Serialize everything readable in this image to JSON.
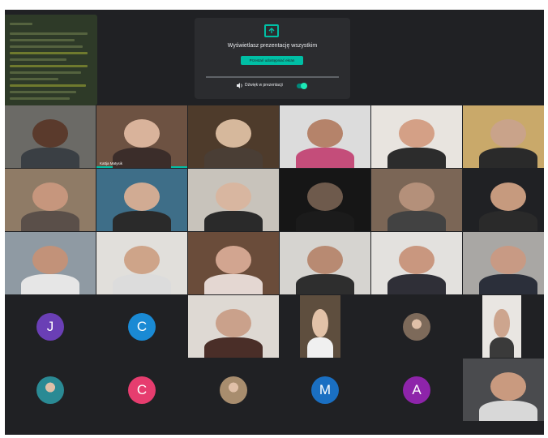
{
  "presentation": {
    "message": "Wyświetlasz prezentację wszystkim",
    "stop_label": "Przestań udostępniać ekran",
    "audio_label": "Dźwięk w prezentacji",
    "audio_on": true
  },
  "tiles": [
    {
      "name": "",
      "bg": "#6b6a66",
      "face": "#5a3a2c",
      "body": "#3a3f44"
    },
    {
      "name": "Kattja Matysik",
      "bg": "#6d5242",
      "face": "#d9b39b",
      "body": "#3b2d2a",
      "speaking": true
    },
    {
      "name": "",
      "bg": "#4e3b2b",
      "face": "#d6b89c",
      "body": "#4a3e35"
    },
    {
      "name": "",
      "bg": "#dcdcdc",
      "face": "#b5836a",
      "body": "#c44d7a"
    },
    {
      "name": "",
      "bg": "#e8e4df",
      "face": "#d4a086",
      "body": "#2c2c2c"
    },
    {
      "name": "",
      "bg": "#c9a96a",
      "face": "#c9a38a",
      "body": "#2a2a2a"
    },
    {
      "name": "",
      "bg": "#8f7b66",
      "face": "#c6967d",
      "body": "#5a4f49"
    },
    {
      "name": "",
      "bg": "#3e6e88",
      "face": "#d1ab93",
      "body": "#2a2a2a"
    },
    {
      "name": "",
      "bg": "#c8c3bb",
      "face": "#d8b6a0",
      "body": "#2a2a2a"
    },
    {
      "name": "",
      "bg": "#161616",
      "face": "#6e5a4c",
      "body": "#1b1b1b"
    },
    {
      "name": "",
      "bg": "#7b6656",
      "face": "#b4907a",
      "body": "#424242"
    },
    {
      "name": "",
      "bg": "#202124",
      "face": "#c69a7e",
      "body": "#2a2a2a"
    },
    {
      "name": "",
      "bg": "#8f9aa3",
      "face": "#c29279",
      "body": "#e6e6e6"
    },
    {
      "name": "",
      "bg": "#e1dfdb",
      "face": "#cea489",
      "body": "#dcdcdc"
    },
    {
      "name": "",
      "bg": "#6a4c3a",
      "face": "#d2a590",
      "body": "#e4d7d2"
    },
    {
      "name": "",
      "bg": "#d6d4d0",
      "face": "#b88a72",
      "body": "#2e2e2e"
    },
    {
      "name": "",
      "bg": "#e3e1de",
      "face": "#c9977f",
      "body": "#2f2f37"
    },
    {
      "name": "",
      "bg": "#a9a7a4",
      "face": "#c89a84",
      "body": "#2b2f3a"
    },
    {
      "name": "",
      "bg": "#ded9d3",
      "face": "#caa18b",
      "body": "#4a2e28"
    },
    {
      "name": "",
      "bg": "#5e4e3e",
      "face": "#e2c2a8",
      "body": "#f0f0f0"
    },
    {
      "name": "",
      "bg": "#e9e6e2",
      "face": "#cda58e",
      "body": "#3a3a3a"
    },
    {
      "name": "",
      "bg": "#4a4b4e",
      "face": "#c99a7f",
      "body": "#d8d8d8"
    }
  ],
  "avatars": [
    {
      "letter": "J",
      "color": "#6a3fb5"
    },
    {
      "letter": "C",
      "color": "#1a8ad4"
    },
    {
      "letter": "C",
      "color": "#e63d6f"
    },
    {
      "letter": "M",
      "color": "#1a6fc2"
    },
    {
      "letter": "A",
      "color": "#8e24aa"
    }
  ],
  "photo_avatars": [
    {
      "color": "#7d6a5a"
    },
    {
      "color": "#2a8a94"
    },
    {
      "color": "#a88d6e"
    }
  ]
}
